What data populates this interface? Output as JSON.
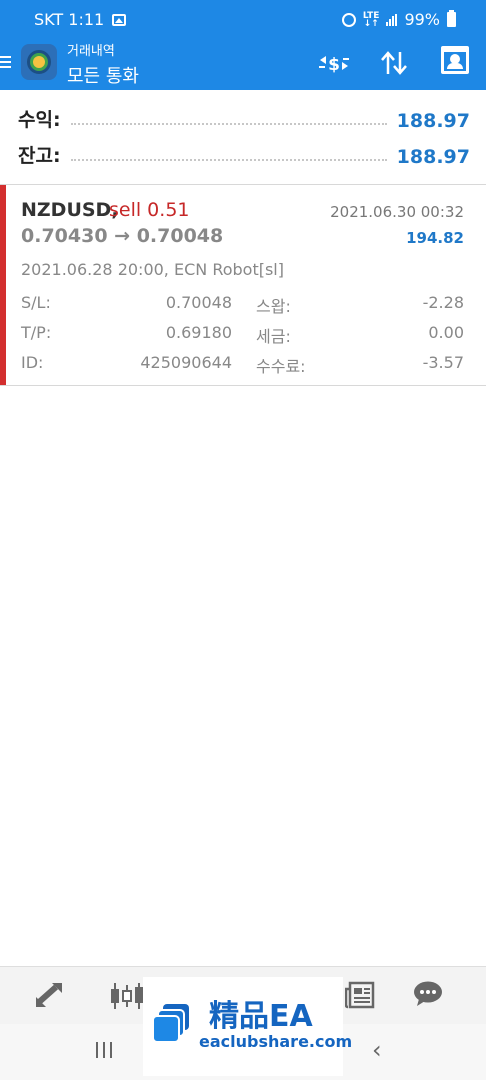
{
  "status_bar": {
    "carrier_time": "SKT 1:11",
    "network": "LTE",
    "battery": "99%",
    "icons": [
      "gallery-icon",
      "alarm-icon",
      "signal-icon",
      "battery-icon"
    ]
  },
  "app_bar": {
    "subtitle": "거래내역",
    "title": "모든 통화",
    "icons": [
      "menu-icon",
      "app-logo",
      "currency-swap-icon",
      "sort-icon",
      "calendar-icon"
    ]
  },
  "summary": {
    "profit_label": "수익:",
    "profit_value": "188.97",
    "balance_label": "잔고:",
    "balance_value": "188.97"
  },
  "deal": {
    "symbol": "NZDUSD,",
    "type": "sell 0.51",
    "close_time": "2021.06.30 00:32",
    "prices": "0.70430 → 0.70048",
    "profit": "194.82",
    "meta": "2021.06.28 20:00, ECN Robot[sl]",
    "sl_label": "S/L:",
    "sl_value": "0.70048",
    "swap_label": "스왑:",
    "swap_value": "-2.28",
    "tp_label": "T/P:",
    "tp_value": "0.69180",
    "tax_label": "세금:",
    "tax_value": "0.00",
    "id_label": "ID:",
    "id_value": "425090644",
    "commission_label": "수수료:",
    "commission_value": "-3.57",
    "accent_color": "#d32f2f"
  },
  "bottom_nav": {
    "icons": [
      "trade-icon",
      "chart-icon",
      "news-icon",
      "chat-icon"
    ]
  },
  "watermark": {
    "title": "精品EA",
    "url": "eaclubshare.com"
  },
  "colors": {
    "primary": "#1e88e5",
    "value_blue": "#1f78c8",
    "sell_red": "#c62828"
  }
}
